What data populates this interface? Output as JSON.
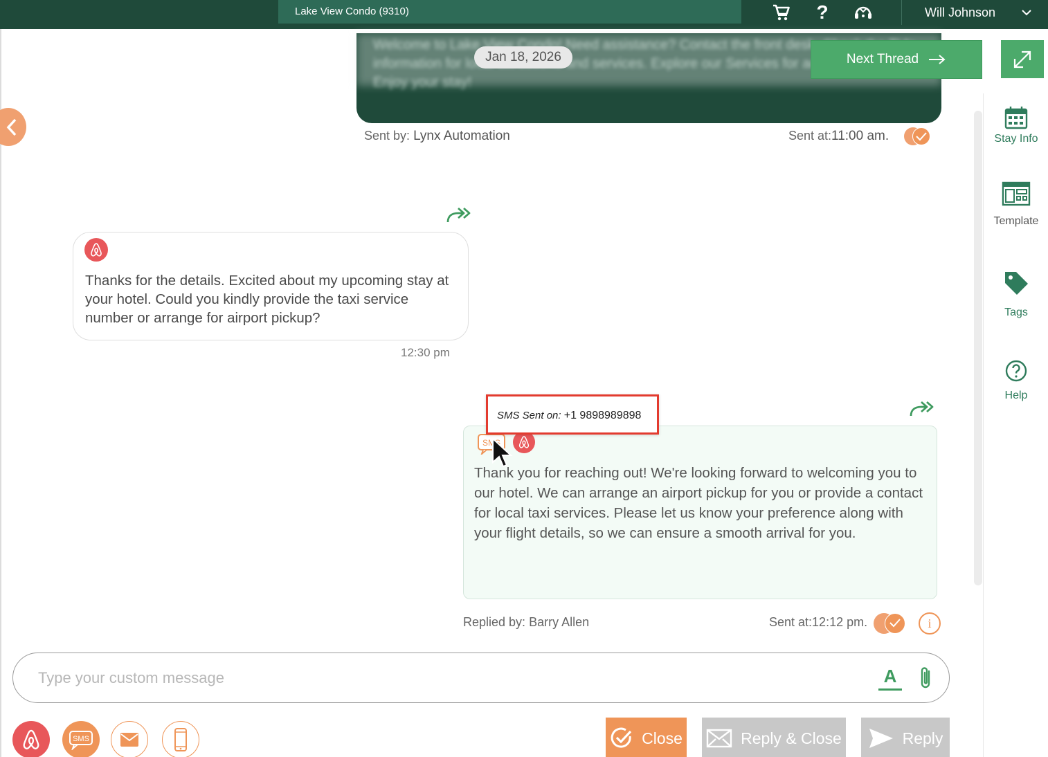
{
  "topbar": {
    "property": "Lake View Condo (9310)",
    "user_name": "Will Johnson",
    "icons": [
      "cart-icon",
      "help-icon",
      "support-icon",
      "chevron-down-icon"
    ]
  },
  "thread": {
    "date": "Jan 18, 2026",
    "next_thread_label": "Next Thread",
    "previous_message": {
      "blurred_text": "Welcome to Lake View Condo! Need assistance? Contact the front desk. Check the TV's information for local attractions and services. Explore our Services for added amenities. Enjoy your stay!",
      "sent_by_label": "Sent by:",
      "sent_by": "Lynx Automation",
      "sent_at_label": "Sent at:",
      "sent_at": "11:00 am."
    },
    "incoming_message": {
      "text": "Thanks for the details. Excited about my upcoming stay at your hotel. Could you kindly provide the taxi service number or arrange for airport pickup?",
      "time": "12:30 pm"
    },
    "tooltip": {
      "label": "SMS Sent on:",
      "number": "+1 9898989898"
    },
    "outgoing_message": {
      "text": "Thank you for reaching out! We're looking forward to welcoming you to our hotel. We can arrange an airport pickup for you or provide a contact for local taxi services. Please let us know your preference along with your flight details, so we can ensure a smooth arrival for you.",
      "replied_by_label": "Replied by:",
      "replied_by": "Barry Allen",
      "sent_at_label": "Sent at:",
      "sent_at": "12:12 pm."
    }
  },
  "composer": {
    "placeholder": "Type your custom message",
    "value": ""
  },
  "channels": {
    "sms_label": "SMS"
  },
  "actions": {
    "close": "Close",
    "reply_close": "Reply & Close",
    "reply": "Reply"
  },
  "sidebar": {
    "items": [
      {
        "label": "Stay Info",
        "icon": "calendar-icon"
      },
      {
        "label": "Template",
        "icon": "template-icon"
      },
      {
        "label": "Tags",
        "icon": "tag-icon"
      },
      {
        "label": "Help",
        "icon": "help-circle-icon"
      }
    ]
  },
  "colors": {
    "header_green": "#1f4a3a",
    "accent_green": "#4caa6b",
    "orange": "#ef9558",
    "airbnb_red": "#e8575a",
    "tooltip_border": "#e33b2f"
  }
}
